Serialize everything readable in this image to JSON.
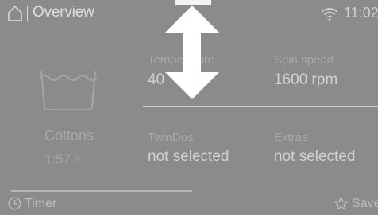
{
  "header": {
    "title": "Overview",
    "time": "11:02",
    "icons": [
      "home-icon",
      "wifi-icon"
    ]
  },
  "program": {
    "name": "Cottons",
    "duration": "1:57",
    "duration_unit": "h",
    "icon": "wash-tub-icon"
  },
  "settings": {
    "temperature": {
      "label": "Temperature",
      "value": "40"
    },
    "spin_speed": {
      "label": "Spin speed",
      "value": "1600 rpm"
    },
    "twindos": {
      "label": "TwinDos",
      "value": "not selected"
    },
    "extras": {
      "label": "Extras",
      "value": "not selected"
    }
  },
  "footer": {
    "timer_label": "Timer",
    "save_label": "Save"
  },
  "overlay": {
    "icon": "vertical-double-arrow-icon"
  }
}
